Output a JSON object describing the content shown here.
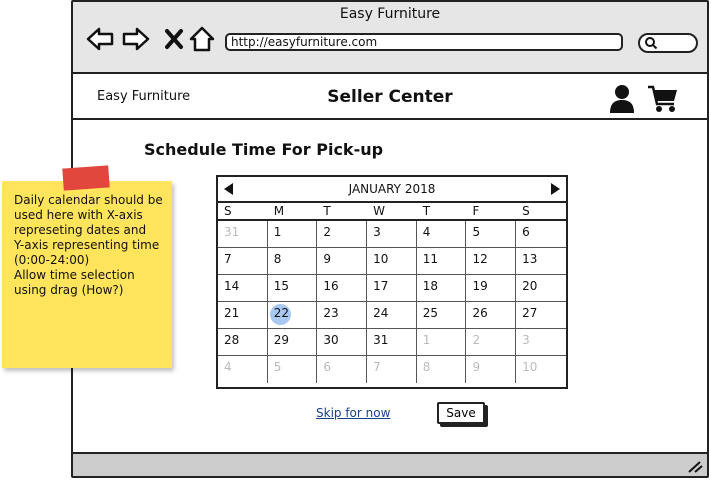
{
  "window": {
    "title": "Easy Furniture"
  },
  "toolbar": {
    "url": "http://easyfurniture.com"
  },
  "header": {
    "brand": "Easy Furniture",
    "title": "Seller Center"
  },
  "page": {
    "heading": "Schedule Time For Pick-up"
  },
  "calendar": {
    "month_label": "JANUARY 2018",
    "weekdays": [
      "S",
      "M",
      "T",
      "W",
      "T",
      "F",
      "S"
    ],
    "weeks": [
      [
        {
          "d": "31",
          "m": true
        },
        {
          "d": "1"
        },
        {
          "d": "2"
        },
        {
          "d": "3"
        },
        {
          "d": "4"
        },
        {
          "d": "5"
        },
        {
          "d": "6"
        }
      ],
      [
        {
          "d": "7"
        },
        {
          "d": "8"
        },
        {
          "d": "9"
        },
        {
          "d": "10"
        },
        {
          "d": "11"
        },
        {
          "d": "12"
        },
        {
          "d": "13"
        }
      ],
      [
        {
          "d": "14"
        },
        {
          "d": "15"
        },
        {
          "d": "16"
        },
        {
          "d": "17"
        },
        {
          "d": "18"
        },
        {
          "d": "19"
        },
        {
          "d": "20"
        }
      ],
      [
        {
          "d": "21"
        },
        {
          "d": "22",
          "s": true
        },
        {
          "d": "23"
        },
        {
          "d": "24"
        },
        {
          "d": "25"
        },
        {
          "d": "26"
        },
        {
          "d": "27"
        }
      ],
      [
        {
          "d": "28"
        },
        {
          "d": "29"
        },
        {
          "d": "30"
        },
        {
          "d": "31"
        },
        {
          "d": "1",
          "m": true
        },
        {
          "d": "2",
          "m": true
        },
        {
          "d": "3",
          "m": true
        }
      ],
      [
        {
          "d": "4",
          "m": true
        },
        {
          "d": "5",
          "m": true
        },
        {
          "d": "6",
          "m": true
        },
        {
          "d": "7",
          "m": true
        },
        {
          "d": "8",
          "m": true
        },
        {
          "d": "9",
          "m": true
        },
        {
          "d": "10",
          "m": true
        }
      ]
    ],
    "selected_color": "#a9c8f2"
  },
  "actions": {
    "skip_label": "Skip for now",
    "save_label": "Save"
  },
  "note": {
    "lines": [
      "Daily calendar should be",
      "used here with X-axis",
      "represeting dates and",
      "Y-axis representing time",
      "(0:00-24:00)",
      "Allow time selection",
      "using drag (How?)"
    ],
    "color": "#ffe45c",
    "tape_color": "#e1473c"
  }
}
